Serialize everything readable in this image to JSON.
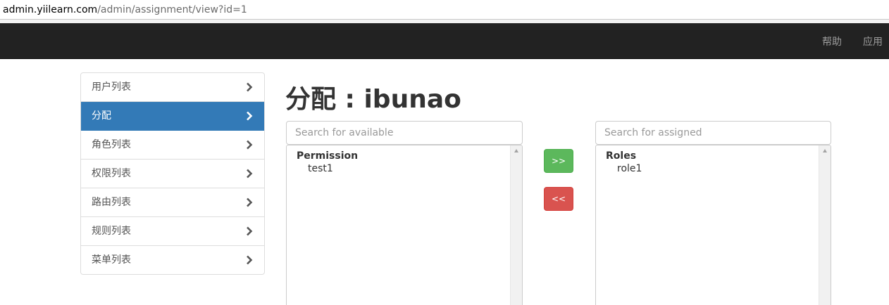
{
  "browser": {
    "url_host": "admin.yiilearn.com",
    "url_path": "/admin/assignment/view?id=1"
  },
  "navbar": {
    "items": [
      {
        "label": "帮助"
      },
      {
        "label": "应用"
      }
    ]
  },
  "sidebar": {
    "items": [
      {
        "label": "用户列表",
        "icon": "chevron-right-icon",
        "active": false
      },
      {
        "label": "分配",
        "icon": "chevron-right-icon",
        "active": true
      },
      {
        "label": "角色列表",
        "icon": "chevron-right-icon",
        "active": false
      },
      {
        "label": "权限列表",
        "icon": "chevron-right-icon",
        "active": false
      },
      {
        "label": "路由列表",
        "icon": "chevron-right-icon",
        "active": false
      },
      {
        "label": "规则列表",
        "icon": "chevron-right-icon",
        "active": false
      },
      {
        "label": "菜单列表",
        "icon": "chevron-right-icon",
        "active": false
      }
    ]
  },
  "main": {
    "title": "分配 : ibunao",
    "available": {
      "placeholder": "Search for available",
      "group": "Permission",
      "options": [
        "test1"
      ]
    },
    "assigned": {
      "placeholder": "Search for assigned",
      "group": "Roles",
      "options": [
        "role1"
      ]
    },
    "assign_button": ">>",
    "remove_button": "<<"
  },
  "colors": {
    "navbar_bg": "#222222",
    "active_item": "#337ab7",
    "assign_button": "#5cb85c",
    "remove_button": "#d9534f"
  }
}
